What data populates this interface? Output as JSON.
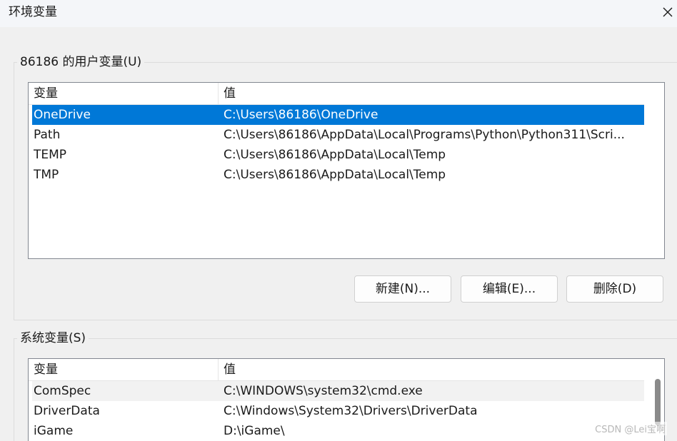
{
  "window": {
    "title": "环境变量",
    "close_icon": "close-icon"
  },
  "user_vars": {
    "group_label": "86186 的用户变量(U)",
    "columns": [
      "变量",
      "值"
    ],
    "rows": [
      {
        "name": "OneDrive",
        "value": "C:\\Users\\86186\\OneDrive",
        "selected": true
      },
      {
        "name": "Path",
        "value": "C:\\Users\\86186\\AppData\\Local\\Programs\\Python\\Python311\\Scri..."
      },
      {
        "name": "TEMP",
        "value": "C:\\Users\\86186\\AppData\\Local\\Temp"
      },
      {
        "name": "TMP",
        "value": "C:\\Users\\86186\\AppData\\Local\\Temp"
      }
    ],
    "buttons": {
      "new": "新建(N)...",
      "edit": "编辑(E)...",
      "delete": "删除(D)"
    }
  },
  "system_vars": {
    "group_label": "系统变量(S)",
    "columns": [
      "变量",
      "值"
    ],
    "rows": [
      {
        "name": "ComSpec",
        "value": "C:\\WINDOWS\\system32\\cmd.exe"
      },
      {
        "name": "DriverData",
        "value": "C:\\Windows\\System32\\Drivers\\DriverData"
      },
      {
        "name": "iGame",
        "value": "D:\\iGame\\"
      }
    ]
  },
  "watermark": "CSDN @Lei宝啊",
  "colors": {
    "selection": "#0078d7",
    "window_bg": "#f0f0f0"
  }
}
